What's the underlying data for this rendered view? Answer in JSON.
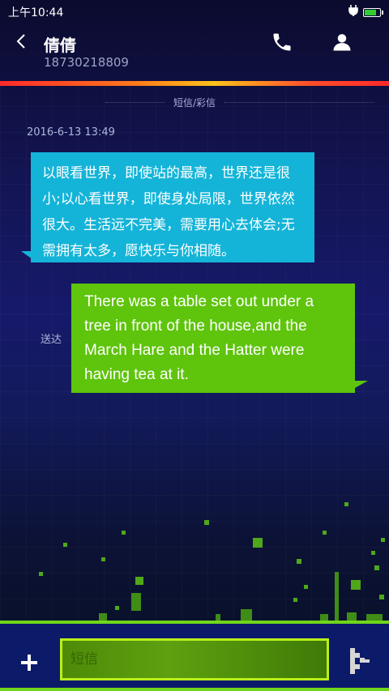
{
  "status_bar": {
    "time": "上午10:44",
    "charging_icon": "plug-icon",
    "battery_icon": "battery-icon"
  },
  "header": {
    "back_icon": "back-arrow-icon",
    "contact_name": "倩倩",
    "contact_number": "18730218809",
    "call_icon": "phone-icon",
    "profile_icon": "person-icon"
  },
  "conversation": {
    "channel_label": "短信/彩信",
    "timestamp": "2016-6-13 13:49",
    "incoming_message": "以眼看世界，即使站的最高，世界还是很小;以心看世界，即使身处局限，世界依然很大。生活远不完美，需要用心去体会;无需拥有太多，愿快乐与你相随。",
    "outgoing_message": "There was a table set out under a tree in front of the house,and the March Hare and the Hatter were having tea at it.",
    "outgoing_status": "送达"
  },
  "composer": {
    "add_icon": "plus-icon",
    "input_placeholder": "短信",
    "send_icon": "send-icon"
  },
  "colors": {
    "incoming_bubble": "#14b4d8",
    "outgoing_bubble": "#5ec40c",
    "accent_green": "#6fd61a",
    "input_border": "#b8f01a"
  }
}
